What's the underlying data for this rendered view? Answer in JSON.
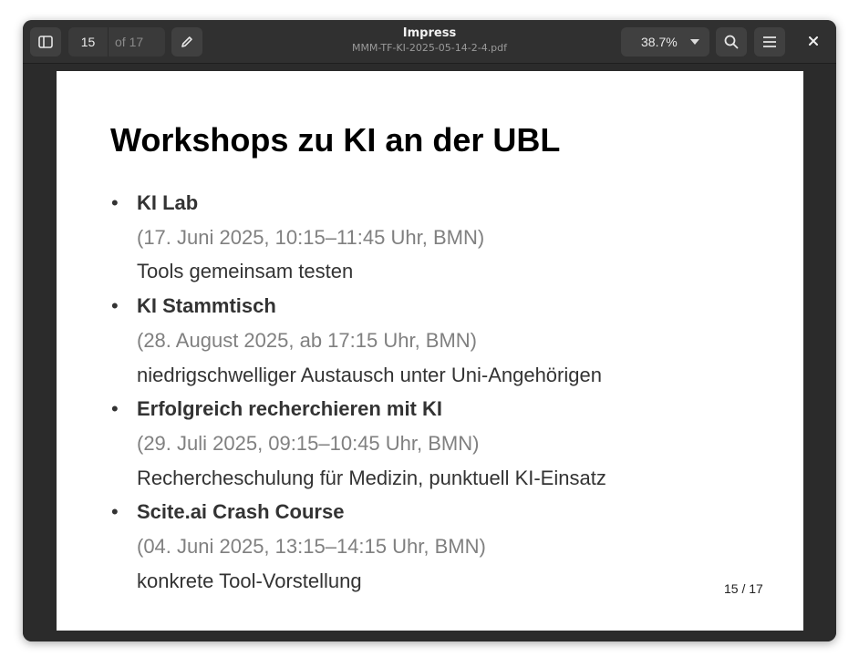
{
  "window": {
    "app_title": "Impress",
    "file_name": "MMM-TF-KI-2025-05-14-2-4.pdf"
  },
  "toolbar": {
    "sidebar_icon": "sidebar-toggle-icon",
    "page_current": "15",
    "page_total": "of 17",
    "edit_icon": "pencil-icon",
    "zoom_level": "38.7%",
    "search_icon": "search-icon",
    "menu_icon": "hamburger-menu-icon",
    "close_icon": "close-icon"
  },
  "slide": {
    "title": "Workshops zu KI an der UBL",
    "bullet_glyph": "•",
    "items": [
      {
        "name": "KI Lab",
        "date": "(17. Juni 2025, 10:15–11:45 Uhr, BMN)",
        "description": "Tools gemeinsam testen"
      },
      {
        "name": "KI Stammtisch",
        "date": "(28. August 2025, ab 17:15 Uhr, BMN)",
        "description": "niedrigschwelliger Austausch unter Uni-Angehörigen"
      },
      {
        "name": "Erfolgreich recherchieren mit KI",
        "date": "(29. Juli 2025, 09:15–10:45 Uhr, BMN)",
        "description": "Rechercheschulung für Medizin, punktuell KI-Einsatz"
      },
      {
        "name": "Scite.ai Crash Course",
        "date": "(04. Juni 2025, 13:15–14:15 Uhr, BMN)",
        "description": "konkrete Tool-Vorstellung"
      }
    ],
    "slide_number": "15 / 17"
  },
  "colors": {
    "window_bg": "#2b2b2b",
    "headerbar_bg": "#303030",
    "button_bg": "#404040",
    "slide_bg": "#ffffff",
    "title_text": "#000000",
    "body_text": "#333333",
    "date_text": "#808080"
  }
}
